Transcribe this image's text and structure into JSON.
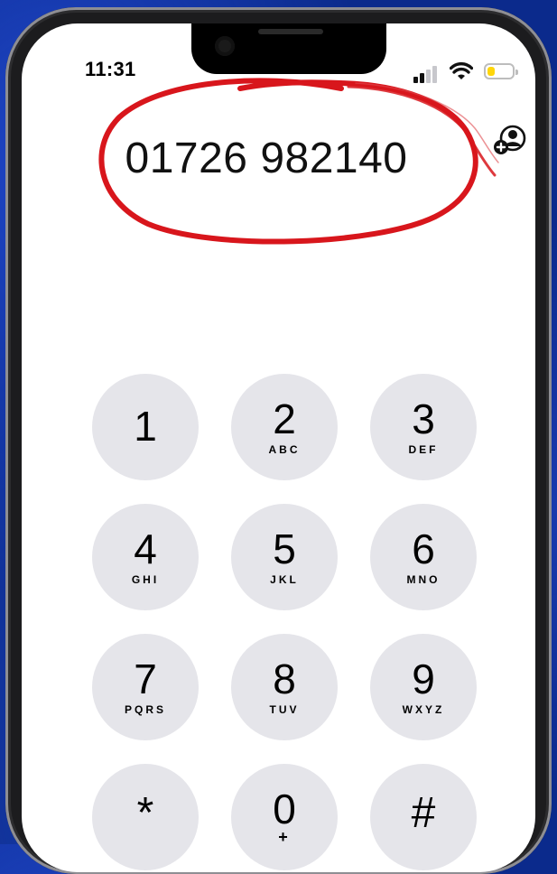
{
  "status_bar": {
    "time": "11:31"
  },
  "dialer": {
    "number": "01726 982140",
    "keys": [
      {
        "digit": "1",
        "letters": ""
      },
      {
        "digit": "2",
        "letters": "ABC"
      },
      {
        "digit": "3",
        "letters": "DEF"
      },
      {
        "digit": "4",
        "letters": "GHI"
      },
      {
        "digit": "5",
        "letters": "JKL"
      },
      {
        "digit": "6",
        "letters": "MNO"
      },
      {
        "digit": "7",
        "letters": "PQRS"
      },
      {
        "digit": "8",
        "letters": "TUV"
      },
      {
        "digit": "9",
        "letters": "WXYZ"
      },
      {
        "digit": "*",
        "letters": ""
      },
      {
        "digit": "0",
        "letters": "+"
      },
      {
        "digit": "#",
        "letters": ""
      }
    ]
  },
  "icons": {
    "signal": "cellular-signal-icon",
    "wifi": "wifi-icon",
    "battery": "battery-icon",
    "add_contact": "add-contact-icon"
  },
  "colors": {
    "background": "#0b2a8c",
    "key_fill": "#e5e5ea",
    "annotation_circle": "#d8161c",
    "battery_fill": "#ffd60a"
  },
  "battery_level": 0.3
}
